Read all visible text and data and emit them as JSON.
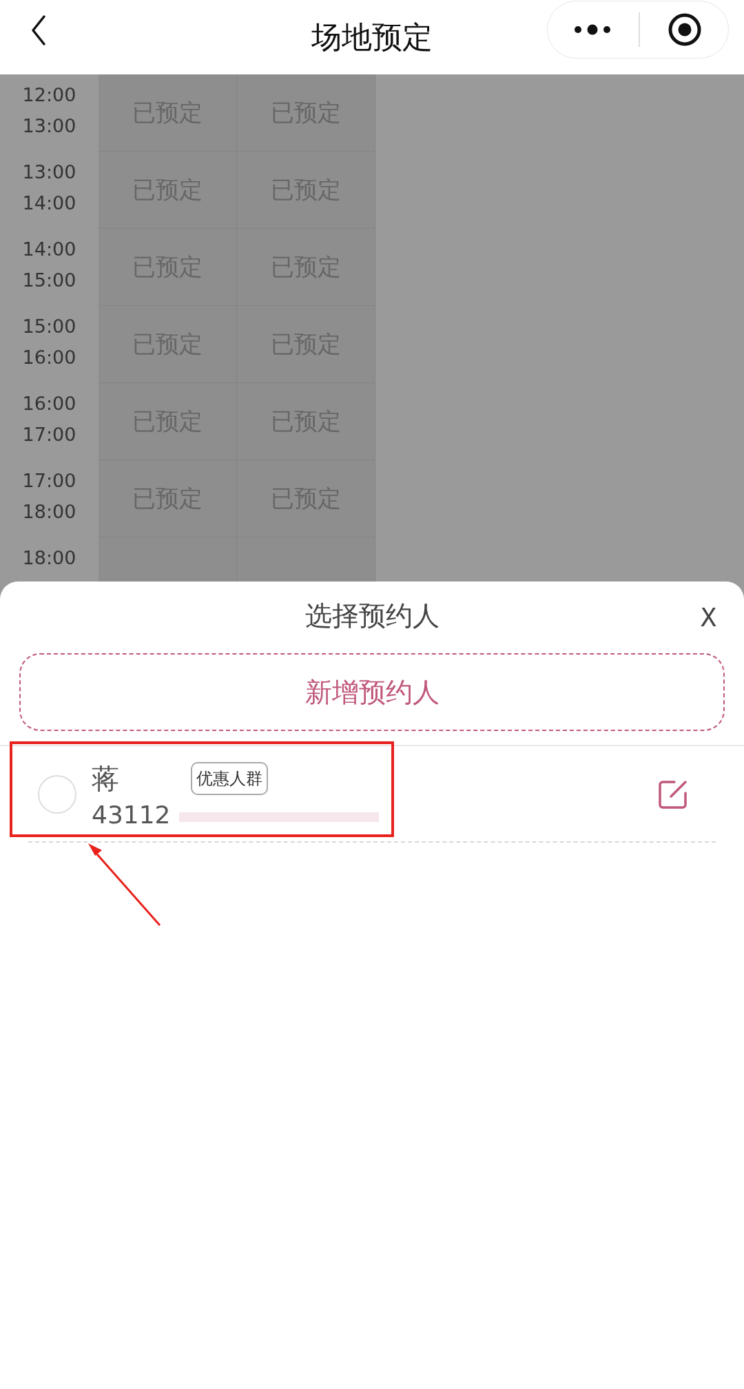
{
  "header": {
    "title": "场地预定"
  },
  "schedule": {
    "rows": [
      {
        "start": "12:00",
        "end": "13:00",
        "slots": [
          "已预定",
          "已预定"
        ]
      },
      {
        "start": "13:00",
        "end": "14:00",
        "slots": [
          "已预定",
          "已预定"
        ]
      },
      {
        "start": "14:00",
        "end": "15:00",
        "slots": [
          "已预定",
          "已预定"
        ]
      },
      {
        "start": "15:00",
        "end": "16:00",
        "slots": [
          "已预定",
          "已预定"
        ]
      },
      {
        "start": "16:00",
        "end": "17:00",
        "slots": [
          "已预定",
          "已预定"
        ]
      },
      {
        "start": "17:00",
        "end": "18:00",
        "slots": [
          "已预定",
          "已预定"
        ]
      },
      {
        "start": "18:00",
        "slots": []
      }
    ]
  },
  "sheet": {
    "title": "选择预约人",
    "close": "X",
    "add_button": "新增预约人",
    "people": [
      {
        "name": "蒋",
        "tag": "优惠人群",
        "id_number": "43112",
        "selected": false
      }
    ]
  }
}
